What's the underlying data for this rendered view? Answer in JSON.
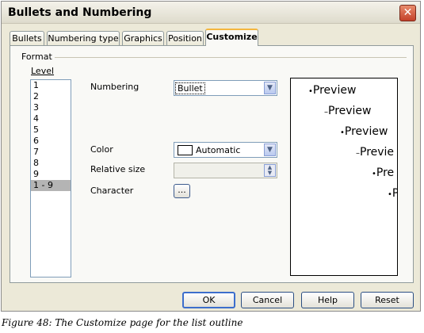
{
  "dialog": {
    "title": "Bullets and Numbering",
    "close_icon": "close-icon"
  },
  "tabs": [
    {
      "label": "Bullets",
      "active": false
    },
    {
      "label": "Numbering type",
      "active": false
    },
    {
      "label": "Graphics",
      "active": false
    },
    {
      "label": "Position",
      "active": false
    },
    {
      "label": "Customize",
      "active": true
    }
  ],
  "format": {
    "label": "Format",
    "level_label": "Level",
    "levels": [
      "1",
      "2",
      "3",
      "4",
      "5",
      "6",
      "7",
      "8",
      "9",
      "1 - 9"
    ],
    "selected_level": "1 - 9",
    "numbering": {
      "label": "Numbering",
      "value": "Bullet"
    },
    "color": {
      "label": "Color",
      "value": "Automatic"
    },
    "relative_size": {
      "label": "Relative size",
      "value": ""
    },
    "character": {
      "label": "Character",
      "button": "..."
    }
  },
  "preview": {
    "lines": [
      {
        "marker": "•",
        "text": "Preview"
      },
      {
        "marker": "–",
        "text": "Preview"
      },
      {
        "marker": "•",
        "text": "Preview"
      },
      {
        "marker": "–",
        "text": "Previe"
      },
      {
        "marker": "•",
        "text": "Pre"
      },
      {
        "marker": "•",
        "text": "P"
      }
    ]
  },
  "buttons": {
    "ok": "OK",
    "cancel": "Cancel",
    "help": "Help",
    "reset": "Reset"
  },
  "caption": "Figure 48: The Customize page for the list outline"
}
